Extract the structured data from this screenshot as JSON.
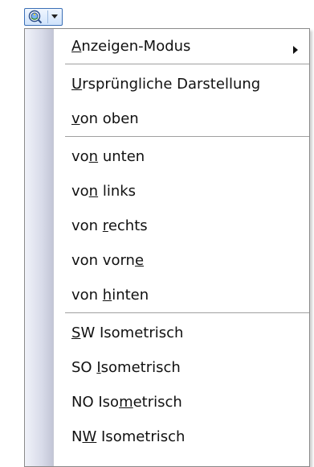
{
  "toolbar": {
    "view_button_icon": "view-orientation-icon",
    "dropdown_icon": "chevron-down-icon",
    "accent": "#3b6fb6"
  },
  "menu": {
    "items": [
      {
        "prefix": "",
        "mnemonic": "A",
        "suffix": "nzeigen-Modus",
        "submenu": true
      },
      {
        "prefix": "",
        "mnemonic": "U",
        "suffix": "rsprüngliche Darstellung",
        "submenu": false
      },
      {
        "prefix": "",
        "mnemonic": "v",
        "suffix": "on oben",
        "submenu": false
      },
      {
        "prefix": "vo",
        "mnemonic": "n",
        "suffix": " unten",
        "submenu": false
      },
      {
        "prefix": "vo",
        "mnemonic": "n",
        "suffix": " links",
        "submenu": false
      },
      {
        "prefix": "von ",
        "mnemonic": "r",
        "suffix": "echts",
        "submenu": false
      },
      {
        "prefix": "von vorn",
        "mnemonic": "e",
        "suffix": "",
        "submenu": false
      },
      {
        "prefix": "von ",
        "mnemonic": "h",
        "suffix": "inten",
        "submenu": false
      },
      {
        "prefix": "",
        "mnemonic": "S",
        "suffix": "W Isometrisch",
        "submenu": false
      },
      {
        "prefix": "SO ",
        "mnemonic": "I",
        "suffix": "sometrisch",
        "submenu": false
      },
      {
        "prefix": "NO Iso",
        "mnemonic": "m",
        "suffix": "etrisch",
        "submenu": false
      },
      {
        "prefix": "N",
        "mnemonic": "W",
        "suffix": " Isometrisch",
        "submenu": false
      }
    ],
    "submenu_arrow_icon": "chevron-right-icon"
  }
}
